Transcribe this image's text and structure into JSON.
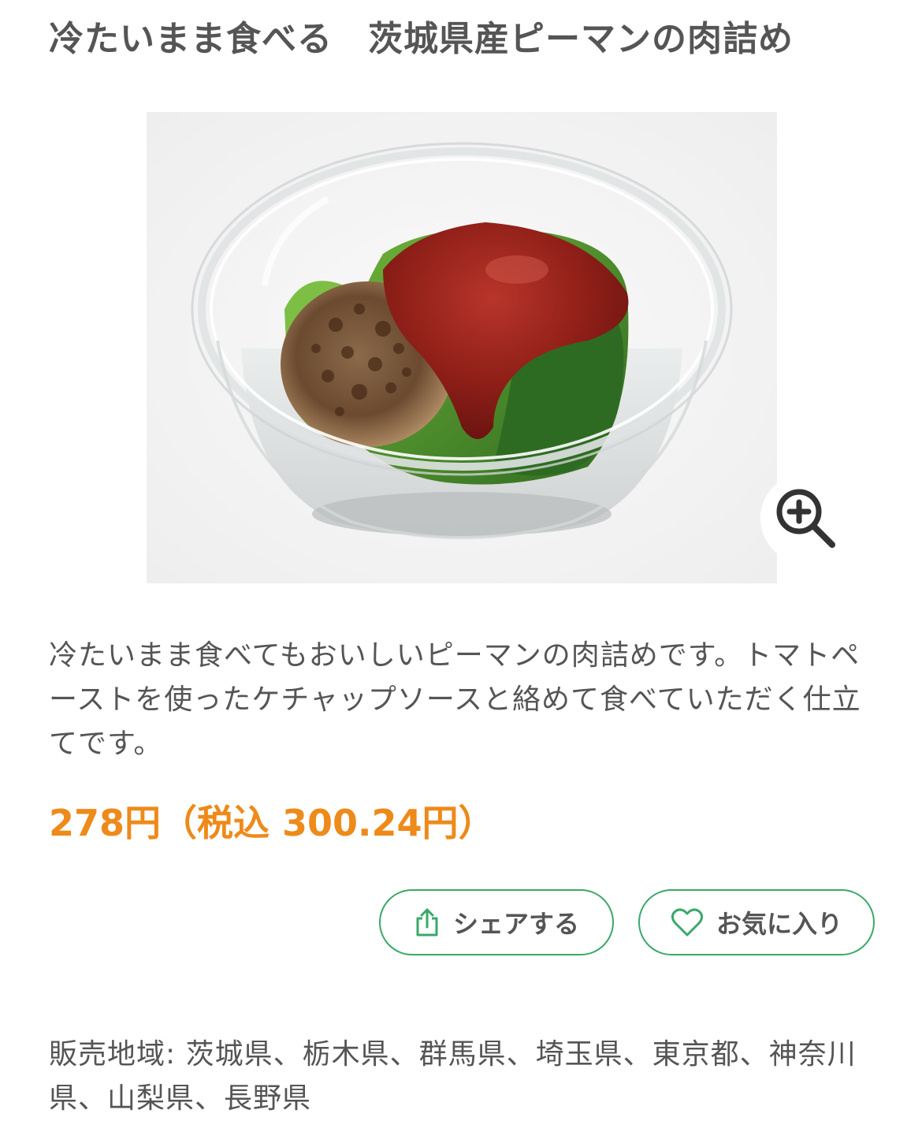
{
  "product": {
    "title": "冷たいまま食べる　茨城県産ピーマンの肉詰め",
    "image_alt": "茨城県産ピーマンの肉詰め",
    "description": "冷たいまま食べてもおいしいピーマンの肉詰めです。トマトペーストを使ったケチャップソースと絡めて食べていただく仕立てです。",
    "price": "278円（税込 300.24円）"
  },
  "actions": {
    "share_label": "シェアする",
    "share_icon": "share-icon",
    "favorite_label": "お気に入り",
    "favorite_icon": "heart-icon",
    "zoom_icon": "zoom-in-icon"
  },
  "sales_region": "販売地域: 茨城県、栃木県、群馬県、埼玉県、東京都、神奈川県、山梨県、長野県",
  "colors": {
    "price": "#ee8a1a",
    "button_border": "#3aa86a",
    "text": "#555555"
  }
}
